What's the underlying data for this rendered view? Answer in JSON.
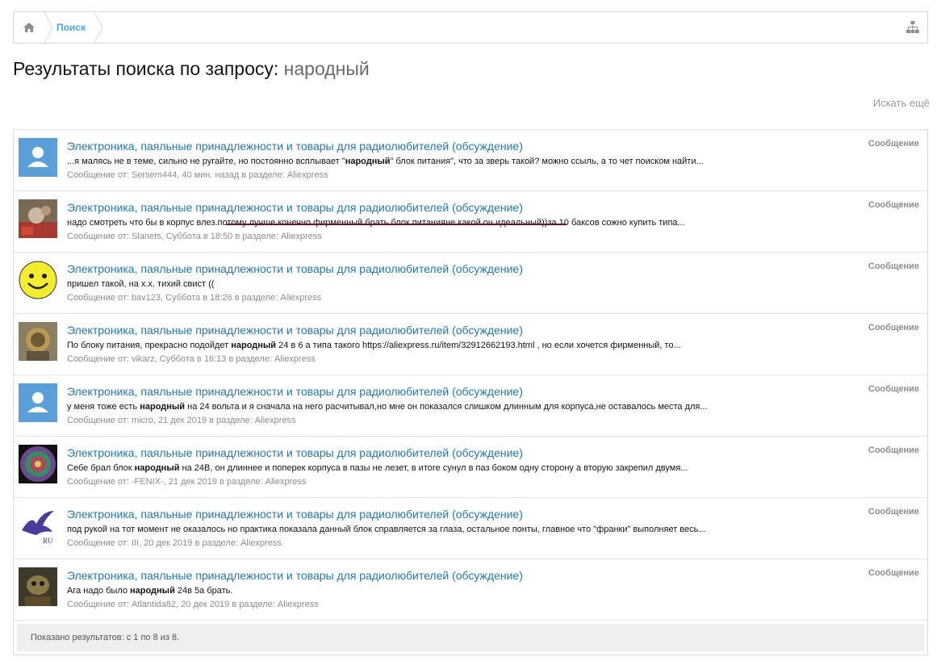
{
  "breadcrumb": {
    "search_label": "Поиск"
  },
  "page": {
    "title_prefix": "Результаты поиска по запросу:",
    "term": "народный",
    "search_again": "Искать ещё"
  },
  "results": [
    {
      "title": "Электроника, паяльные принадлежности и товары для радиолюбителей (обсуждение)",
      "snippet_before": "...я малясь не в теме, сильно не ругайте, но постоянно всплывает \"",
      "snippet_bold": "народный",
      "snippet_after": "\" блок питания\", что за зверь такой? можно ссыль, а то чет поиском найти...",
      "meta": "Сообщение от: Sersem444, 40 мин. назад в разделе: Aliexpress",
      "type": "Сообщение",
      "avatar": "default-user-icon"
    },
    {
      "title": "Электроника, паяльные принадлежности и товары для радиолюбителей (обсуждение)",
      "snippet_before": "надо смотреть что бы в корпус влез.потому лучше конечно фирменный брать блок питанияне какой.он идеальный))за 10 баксов сожно купить типа...",
      "snippet_bold": "",
      "snippet_after": "",
      "meta": "Сообщение от: Slanets, Суббота в 18:50 в разделе: Aliexpress",
      "type": "Сообщение",
      "avatar": "photo-avatar"
    },
    {
      "title": "Электроника, паяльные принадлежности и товары для радиолюбителей (обсуждение)",
      "snippet_before": "пришел такой, на х.х. тихий свист ((",
      "snippet_bold": "",
      "snippet_after": "",
      "meta": "Сообщение от: bav123, Суббота в 18:26 в разделе: Aliexpress",
      "type": "Сообщение",
      "avatar": "smiley-avatar"
    },
    {
      "title": "Электроника, паяльные принадлежности и товары для радиолюбителей (обсуждение)",
      "snippet_before": "По блоку питания, прекрасно подойдет ",
      "snippet_bold": "народный",
      "snippet_after": " 24 в 6 а типа такого https://aliexpress.ru/item/32912662193.html , но если хочется фирменный, то...",
      "meta": "Сообщение от: vikarz, Суббота в 16:13 в разделе: Aliexpress",
      "type": "Сообщение",
      "avatar": "robot-avatar"
    },
    {
      "title": "Электроника, паяльные принадлежности и товары для радиолюбителей (обсуждение)",
      "snippet_before": "у меня тоже есть ",
      "snippet_bold": "народный",
      "snippet_after": " на 24 вольта и я сначала на него расчитывал,но мне он показался слишком длинным для корпуса,не оставалось места для...",
      "meta": "Сообщение от: micro, 21 дек 2019 в разделе: Aliexpress",
      "type": "Сообщение",
      "avatar": "default-user-icon"
    },
    {
      "title": "Электроника, паяльные принадлежности и товары для радиолюбителей (обсуждение)",
      "snippet_before": "Себе брал блок ",
      "snippet_bold": "народный",
      "snippet_after": " на 24В, он длиннее и поперек корпуса в пазы не лезет, в итоге сунул в паз боком одну сторону а вторую закрепил двумя...",
      "meta": "Сообщение от: -FENIX-, 21 дек 2019 в разделе: Aliexpress",
      "type": "Сообщение",
      "avatar": "pattern-avatar"
    },
    {
      "title": "Электроника, паяльные принадлежности и товары для радиолюбителей (обсуждение)",
      "snippet_before": "под рукой на тот момент не оказалось но практика показала данный блок справляется за глаза, остальное понты, главное что \"франки\" выполняет весь...",
      "snippet_bold": "",
      "snippet_after": "",
      "meta": "Сообщение от: III, 20 дек 2019 в разделе: Aliexpress",
      "type": "Сообщение",
      "avatar": "bird-avatar",
      "avatar_text": "RU"
    },
    {
      "title": "Электроника, паяльные принадлежности и товары для радиолюбителей (обсуждение)",
      "snippet_before": "Ага надо было ",
      "snippet_bold": "народный",
      "snippet_after": " 24в 5а брать.",
      "meta": "Сообщение от: Atlantida82, 20 дек 2019 в разделе: Aliexpress",
      "type": "Сообщение",
      "avatar": "photo-avatar-2"
    }
  ],
  "footer": {
    "text": "Показано результатов: с 1 по 8 из 8."
  }
}
